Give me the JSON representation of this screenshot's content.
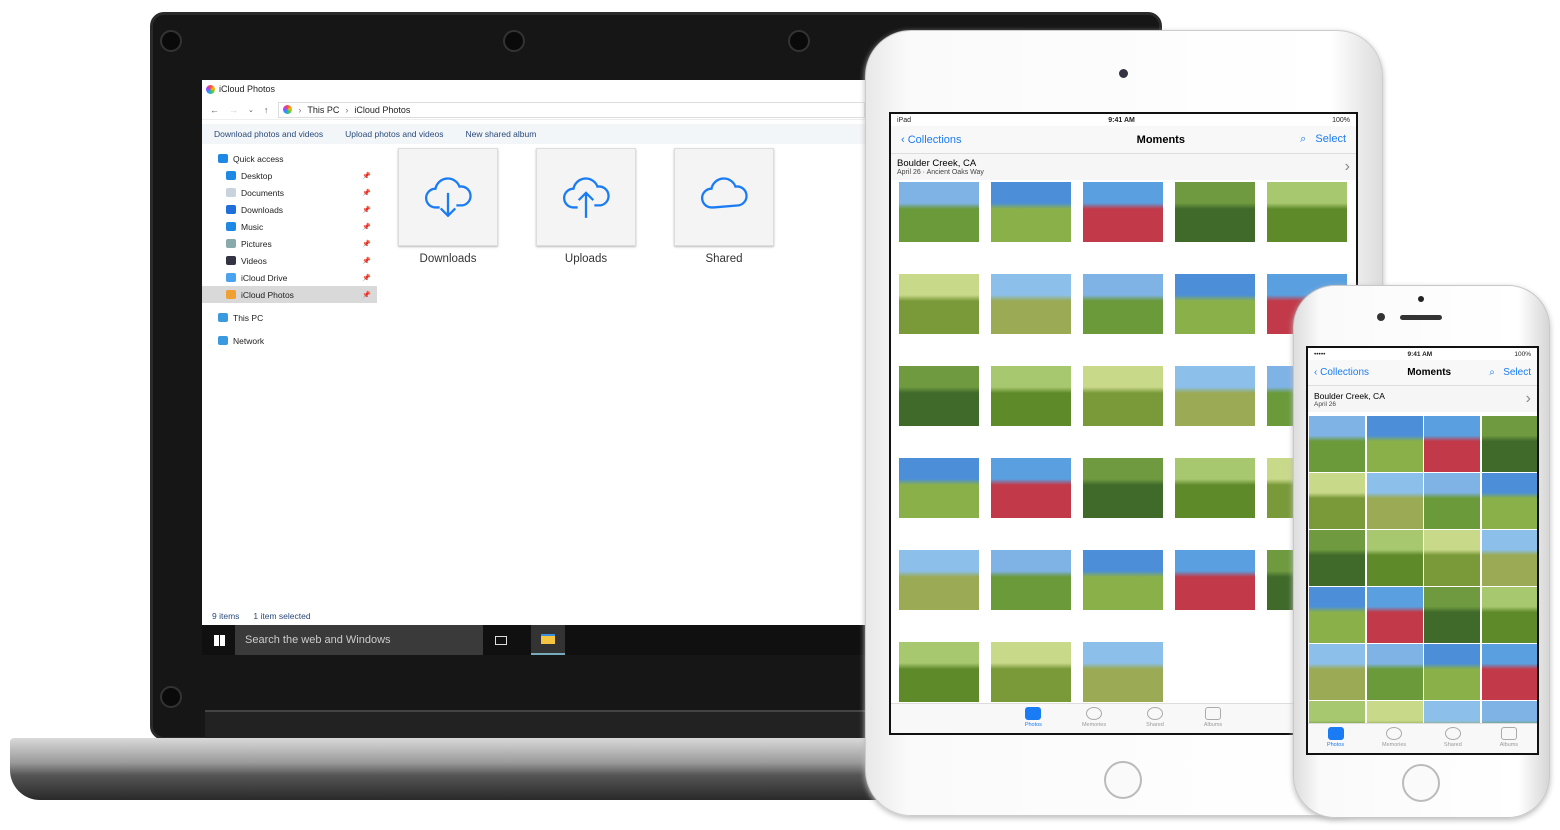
{
  "explorer": {
    "window_title": "iCloud Photos",
    "breadcrumb": [
      "This PC",
      "iCloud Photos"
    ],
    "ribbon": [
      "Download photos and videos",
      "Upload photos and videos",
      "New shared album"
    ],
    "nav": [
      {
        "label": "Quick access",
        "icon": "star-icon",
        "color": "#1e88e5",
        "level": 0
      },
      {
        "label": "Desktop",
        "icon": "desktop-icon",
        "color": "#1e88e5",
        "level": 1,
        "pinned": true
      },
      {
        "label": "Documents",
        "icon": "document-icon",
        "color": "#c9d3de",
        "level": 1,
        "pinned": true
      },
      {
        "label": "Downloads",
        "icon": "download-arrow-icon",
        "color": "#1e6fd9",
        "level": 1,
        "pinned": true
      },
      {
        "label": "Music",
        "icon": "music-note-icon",
        "color": "#1e88e5",
        "level": 1,
        "pinned": true
      },
      {
        "label": "Pictures",
        "icon": "pictures-icon",
        "color": "#8aa",
        "level": 1,
        "pinned": true
      },
      {
        "label": "Videos",
        "icon": "film-icon",
        "color": "#334",
        "level": 1,
        "pinned": true
      },
      {
        "label": "iCloud Drive",
        "icon": "cloud-icon",
        "color": "#4aa3f0",
        "level": 1,
        "pinned": true
      },
      {
        "label": "iCloud Photos",
        "icon": "photos-icon",
        "color": "#f0a030",
        "level": 1,
        "pinned": true,
        "selected": true
      },
      {
        "label": "This PC",
        "icon": "computer-icon",
        "color": "#3a9ae0",
        "level": 0
      },
      {
        "label": "Network",
        "icon": "network-icon",
        "color": "#3a9ae0",
        "level": 0
      }
    ],
    "folders": [
      {
        "label": "Downloads",
        "icon": "cloud-download-icon"
      },
      {
        "label": "Uploads",
        "icon": "cloud-upload-icon"
      },
      {
        "label": "Shared",
        "icon": "cloud-icon"
      }
    ],
    "status": {
      "items": "9 items",
      "selected": "1 item selected"
    },
    "taskbar_search": "Search the web and Windows"
  },
  "ipad": {
    "status": {
      "carrier": "iPad",
      "time": "9:41 AM",
      "battery": "100%"
    },
    "back": "Collections",
    "title": "Moments",
    "select": "Select",
    "moment": {
      "place": "Boulder Creek, CA",
      "sub": "April 26 · Ancient Oaks Way"
    }
  },
  "iphone": {
    "status": {
      "carrier": "•••••",
      "time": "9:41 AM",
      "battery": "100%"
    },
    "back": "Collections",
    "title": "Moments",
    "select": "Select",
    "moment": {
      "place": "Boulder Creek, CA",
      "sub": "April 26"
    }
  },
  "tabs": [
    {
      "label": "Photos",
      "active": true
    },
    {
      "label": "Memories"
    },
    {
      "label": "Shared"
    },
    {
      "label": "Albums"
    }
  ],
  "accent": "#1a7cf5"
}
